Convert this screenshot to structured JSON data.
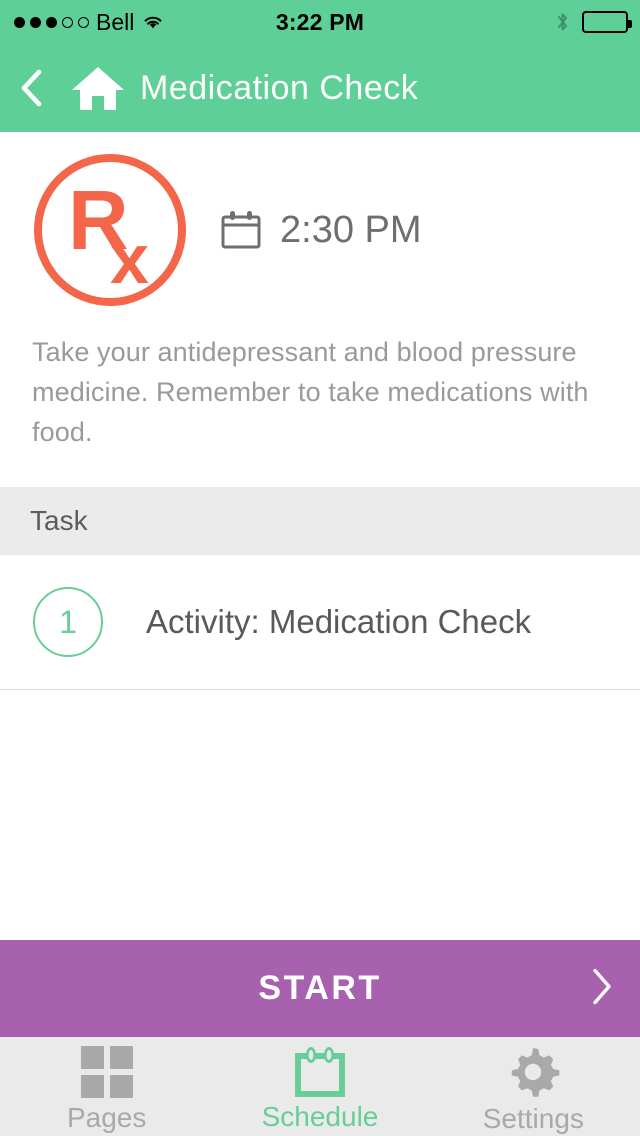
{
  "status_bar": {
    "signal_dots_filled": 3,
    "signal_dots_total": 5,
    "carrier": "Bell",
    "wifi_icon": "wifi-icon",
    "time": "3:22 PM",
    "bluetooth_icon": "bluetooth-icon",
    "battery_icon": "battery-full-icon"
  },
  "navbar": {
    "back_icon": "chevron-left-icon",
    "home_icon": "home-icon",
    "title": "Medication Check",
    "background_color": "#5ECF96"
  },
  "activity": {
    "rx_icon": "prescription-rx-icon",
    "rx_letter_main": "R",
    "rx_letter_sub": "x",
    "rx_color": "#F4664A",
    "calendar_icon": "calendar-icon",
    "scheduled_time": "2:30 PM",
    "description": "Take your antidepressant and blood pressure medicine. Remember to take medications with food."
  },
  "task_section": {
    "header_label": "Task",
    "items": [
      {
        "number": "1",
        "label": "Activity: Medication Check"
      }
    ]
  },
  "start_button": {
    "label": "START",
    "chevron_icon": "chevron-right-icon",
    "background_color": "#A861AE"
  },
  "tabbar": {
    "tabs": [
      {
        "label": "Pages",
        "icon": "grid-icon",
        "active": false
      },
      {
        "label": "Schedule",
        "icon": "calendar-icon",
        "active": true
      },
      {
        "label": "Settings",
        "icon": "gear-icon",
        "active": false
      }
    ],
    "active_color": "#68CE98",
    "inactive_color": "#A9A9A9"
  }
}
